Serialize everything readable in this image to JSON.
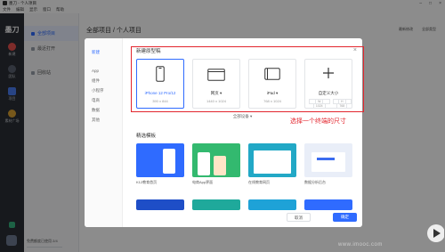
{
  "window": {
    "title": "墨刀 - 个人项目"
  },
  "menu": [
    "文件",
    "编辑",
    "显示",
    "窗口",
    "帮助"
  ],
  "rail": {
    "logo": "墨刀",
    "items": [
      {
        "label": "新建"
      },
      {
        "label": "团队"
      },
      {
        "label": "项目"
      },
      {
        "label": "素材广场"
      }
    ]
  },
  "sidebar": {
    "items": [
      {
        "label": "全部项目"
      },
      {
        "label": "最近打开"
      },
      {
        "label": "回收站"
      }
    ],
    "bottom_text": "免费额度已使用 2/4"
  },
  "header": {
    "breadcrumb": "全部项目 / 个人项目",
    "right": [
      "最新修改",
      "全部类型"
    ]
  },
  "dialog": {
    "nav": [
      {
        "label": "新建",
        "active": true
      },
      {
        "label": "App"
      },
      {
        "label": "组件"
      },
      {
        "label": "小程序"
      },
      {
        "label": "电商"
      },
      {
        "label": "数据"
      },
      {
        "label": "其他"
      }
    ],
    "section_title": "新建原型稿",
    "close": "×",
    "devices": [
      {
        "name": "iPhone 12 Pro/12",
        "size": "390 x 844",
        "selected": true
      },
      {
        "name": "网页",
        "size": "1440 x 1024",
        "selected": false
      },
      {
        "name": "iPad",
        "size": "768 x 1024",
        "selected": false
      },
      {
        "name": "自定义大小",
        "width_label": "W",
        "width_value": "1024",
        "height_label": "H",
        "height_value": "768",
        "selected": false
      }
    ],
    "all_devices": "全部设备",
    "templates_title": "精选模板",
    "templates": [
      {
        "label": "K12教育首页",
        "color": "#2f6bff"
      },
      {
        "label": "电商App界面",
        "color": "#33b96f"
      },
      {
        "label": "在线教育网页",
        "color": "#22a8c6"
      },
      {
        "label": "数据分析后台",
        "color": "#e9eef8"
      }
    ],
    "template_row2_colors": [
      "#1e4ec7",
      "#1fa99b",
      "#1ea2d7",
      "#2f6bff"
    ],
    "cancel_label": "取消",
    "confirm_label": "确定"
  },
  "annotation": {
    "text": "选择一个终端的尺寸",
    "color": "#e3262e"
  },
  "watermark": "www.imooc.com"
}
